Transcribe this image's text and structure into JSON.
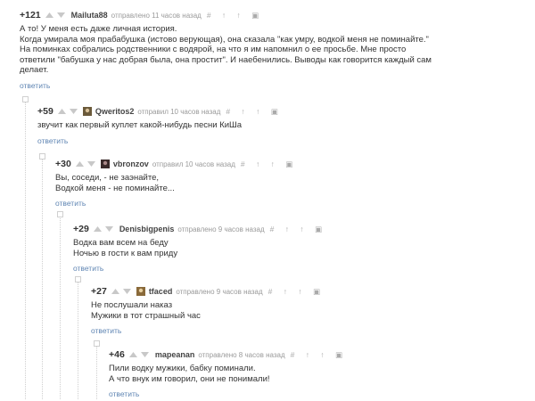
{
  "ui": {
    "reply_label": "ответить",
    "tools": "# ↑ ↑ ▣"
  },
  "comments": [
    {
      "rating": "+121",
      "user": "Mailuta88",
      "meta": "отправлено 11 часов назад",
      "lines": [
        "А то! У меня есть даже личная история.",
        "Когда умирала моя прабабушка (истово верующая), она сказала \"как умру, водкой меня не поминайте.\"",
        "На поминках собрались родственники с водярой, на что я им напомнил о ее просьбе. Мне просто",
        "ответили \"бабушка у нас добрая была, она простит\". И наебенились. Выводы как говорится каждый сам",
        "делает."
      ]
    },
    {
      "rating": "+59",
      "user": "Qweritos2",
      "meta": "отправил 10 часов назад",
      "lines": [
        "звучит как первый куплет какой-нибудь песни КиШа"
      ]
    },
    {
      "rating": "+30",
      "user": "vbronzov",
      "meta": "отправил 10 часов назад",
      "lines": [
        "Вы, соседи, - не заэнайте,",
        "Водкой меня - не поминайте..."
      ]
    },
    {
      "rating": "+29",
      "user": "Denisbigpenis",
      "meta": "отправлено 9 часов назад",
      "lines": [
        "Водка вам всем на беду",
        "Ночью в гости к вам приду"
      ]
    },
    {
      "rating": "+27",
      "user": "tfaced",
      "meta": "отправлено 9 часов назад",
      "lines": [
        "Не послушали наказ",
        "Мужики в тот страшный час"
      ]
    },
    {
      "rating": "+46",
      "user": "mapeanan",
      "meta": "отправлено 8 часов назад",
      "lines": [
        "Пили водку мужики, бабку поминали.",
        "А что внук им говорил, они не понимали!"
      ]
    }
  ]
}
